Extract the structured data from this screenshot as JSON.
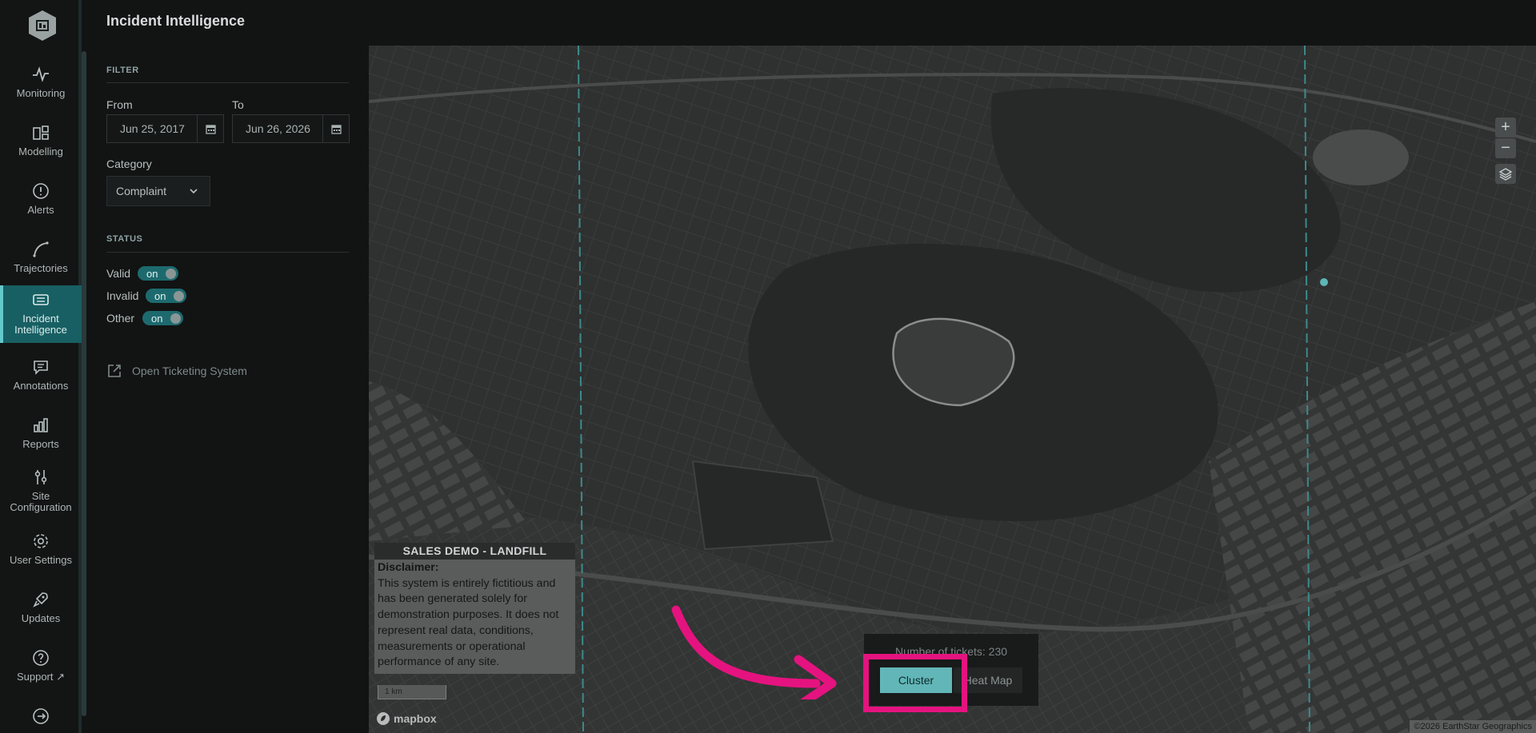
{
  "app": {
    "title": "Incident Intelligence"
  },
  "nav": {
    "items": [
      {
        "key": "monitoring",
        "label": "Monitoring",
        "icon": "pulse-icon"
      },
      {
        "key": "modelling",
        "label": "Modelling",
        "icon": "layout-grid-icon"
      },
      {
        "key": "alerts",
        "label": "Alerts",
        "icon": "alert-circle-icon"
      },
      {
        "key": "trajectories",
        "label": "Trajectories",
        "icon": "curve-icon"
      },
      {
        "key": "incident",
        "label": "Incident Intelligence",
        "icon": "ticket-icon",
        "active": true
      },
      {
        "key": "annotations",
        "label": "Annotations",
        "icon": "message-icon"
      },
      {
        "key": "reports",
        "label": "Reports",
        "icon": "bar-chart-icon"
      },
      {
        "key": "site_config",
        "label": "Site Configuration",
        "icon": "sliders-icon"
      },
      {
        "key": "user_settings",
        "label": "User Settings",
        "icon": "gear-icon"
      },
      {
        "key": "updates",
        "label": "Updates",
        "icon": "rocket-icon"
      },
      {
        "key": "support",
        "label": "Support",
        "icon": "help-circle-icon"
      },
      {
        "key": "logout",
        "label": "",
        "icon": "logout-icon"
      }
    ]
  },
  "filter": {
    "section_label": "FILTER",
    "from_label": "From",
    "from_value": "Jun 25, 2017",
    "to_label": "To",
    "to_value": "Jun 26, 2026",
    "category_label": "Category",
    "category_value": "Complaint"
  },
  "status": {
    "section_label": "STATUS",
    "toggles": [
      {
        "label": "Valid",
        "state": "on"
      },
      {
        "label": "Invalid",
        "state": "on"
      },
      {
        "label": "Other",
        "state": "on"
      }
    ]
  },
  "links": {
    "open_ticketing": "Open Ticketing System"
  },
  "map": {
    "zoom_in": "+",
    "zoom_out": "−",
    "disclaimer_title": "SALES DEMO - LANDFILL",
    "disclaimer_heading": "Disclaimer:",
    "disclaimer_text": "This system is entirely fictitious and has been generated solely for demonstration purposes. It does not represent real data, conditions, measurements or operational performance of any site.",
    "scale_label": "1 km",
    "logo_text": "mapbox",
    "attribution": "©2026 EarthStar Geographics",
    "ticket_count_label": "Number of tickets: 230",
    "cluster_label": "Cluster",
    "heatmap_label": "Heat Map"
  },
  "colors": {
    "accent": "#63c9cb",
    "active_nav": "#185f63",
    "highlight": "#e5137f",
    "cluster_button": "#62b6b8"
  }
}
